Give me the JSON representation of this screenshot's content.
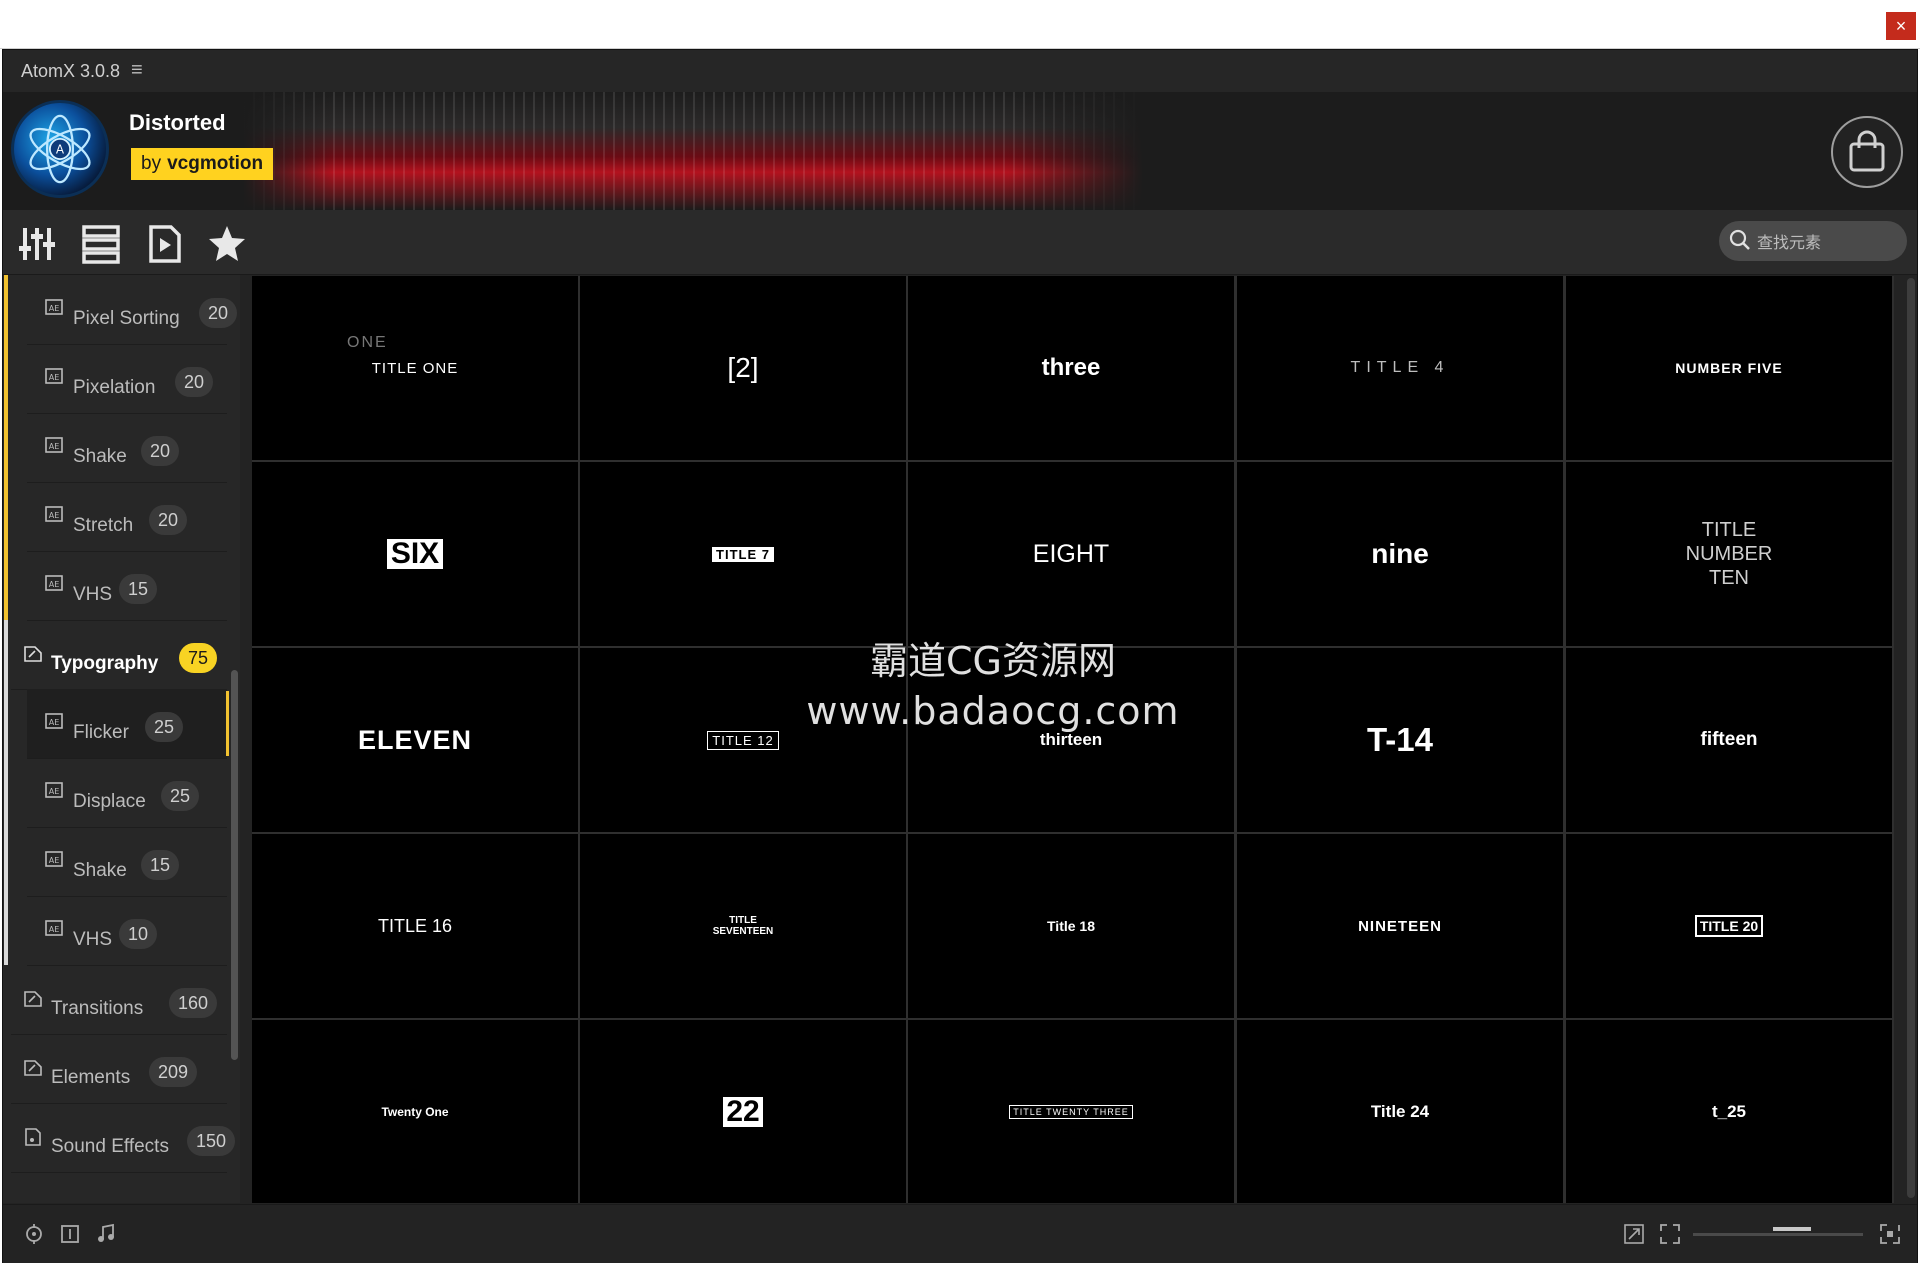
{
  "window": {
    "title": "AtomX 3.0.8",
    "close_glyph": "×"
  },
  "pack": {
    "name": "Distorted",
    "by": "by",
    "author": "vcgmotion"
  },
  "search": {
    "placeholder": "查找元素"
  },
  "toolbar": {
    "icons": [
      "sliders-icon",
      "layers-icon",
      "play-document-icon",
      "star-icon"
    ]
  },
  "sidebar": {
    "items": [
      {
        "label": "Pixel Sorting",
        "count": "20",
        "kind": "sub"
      },
      {
        "label": "Pixelation",
        "count": "20",
        "kind": "sub"
      },
      {
        "label": "Shake",
        "count": "20",
        "kind": "sub"
      },
      {
        "label": "Stretch",
        "count": "20",
        "kind": "sub"
      },
      {
        "label": "VHS",
        "count": "15",
        "kind": "sub"
      },
      {
        "label": "Typography",
        "count": "75",
        "kind": "category",
        "expanded": true
      },
      {
        "label": "Flicker",
        "count": "25",
        "kind": "sub",
        "active": true
      },
      {
        "label": "Displace",
        "count": "25",
        "kind": "sub"
      },
      {
        "label": "Shake",
        "count": "15",
        "kind": "sub"
      },
      {
        "label": "VHS",
        "count": "10",
        "kind": "sub"
      },
      {
        "label": "Transitions",
        "count": "160",
        "kind": "category"
      },
      {
        "label": "Elements",
        "count": "209",
        "kind": "category"
      },
      {
        "label": "Sound Effects",
        "count": "150",
        "kind": "category"
      }
    ]
  },
  "grid": {
    "tiles": [
      {
        "text": "TITLE ONE",
        "ghost": "ONE",
        "style": "t1"
      },
      {
        "text": "[2]",
        "style": "t2"
      },
      {
        "text": "three",
        "style": "t3"
      },
      {
        "text": "TITLE 4",
        "style": "t4"
      },
      {
        "text": "NUMBER FIVE",
        "style": "t5"
      },
      {
        "text": "SIX",
        "style": "t6"
      },
      {
        "text": "TITLE 7",
        "style": "t7"
      },
      {
        "text": "EIGHT",
        "style": "t8"
      },
      {
        "text": "nine",
        "style": "t9"
      },
      {
        "text": "TITLE NUMBER TEN",
        "style": "t10"
      },
      {
        "text": "ELEVEN",
        "style": "t11"
      },
      {
        "text": "TITLE 12",
        "style": "t12"
      },
      {
        "text": "thirteen",
        "style": "t13"
      },
      {
        "text": "T-14",
        "style": "t14"
      },
      {
        "text": "fifteen",
        "style": "t15"
      },
      {
        "text": "TITLE 16",
        "style": "t16"
      },
      {
        "text": "TITLE SEVENTEEN",
        "style": "t17"
      },
      {
        "text": "Title 18",
        "style": "t18"
      },
      {
        "text": "NINETEEN",
        "style": "t19"
      },
      {
        "text": "TITLE 20",
        "style": "t20"
      },
      {
        "text": "Twenty One",
        "style": "t21"
      },
      {
        "text": "22",
        "style": "t22"
      },
      {
        "text": "TITLE TWENTY THREE",
        "style": "t23"
      },
      {
        "text": "Title 24",
        "style": "t24"
      },
      {
        "text": "t_25",
        "style": "t25"
      }
    ]
  },
  "watermark": {
    "line1": "霸道CG资源网",
    "line2": "www.badaocg.com"
  },
  "colors": {
    "accent": "#f2c230",
    "badge_active": "#f8d323",
    "author_badge": "#ffd21f",
    "close": "#c42b1c"
  }
}
